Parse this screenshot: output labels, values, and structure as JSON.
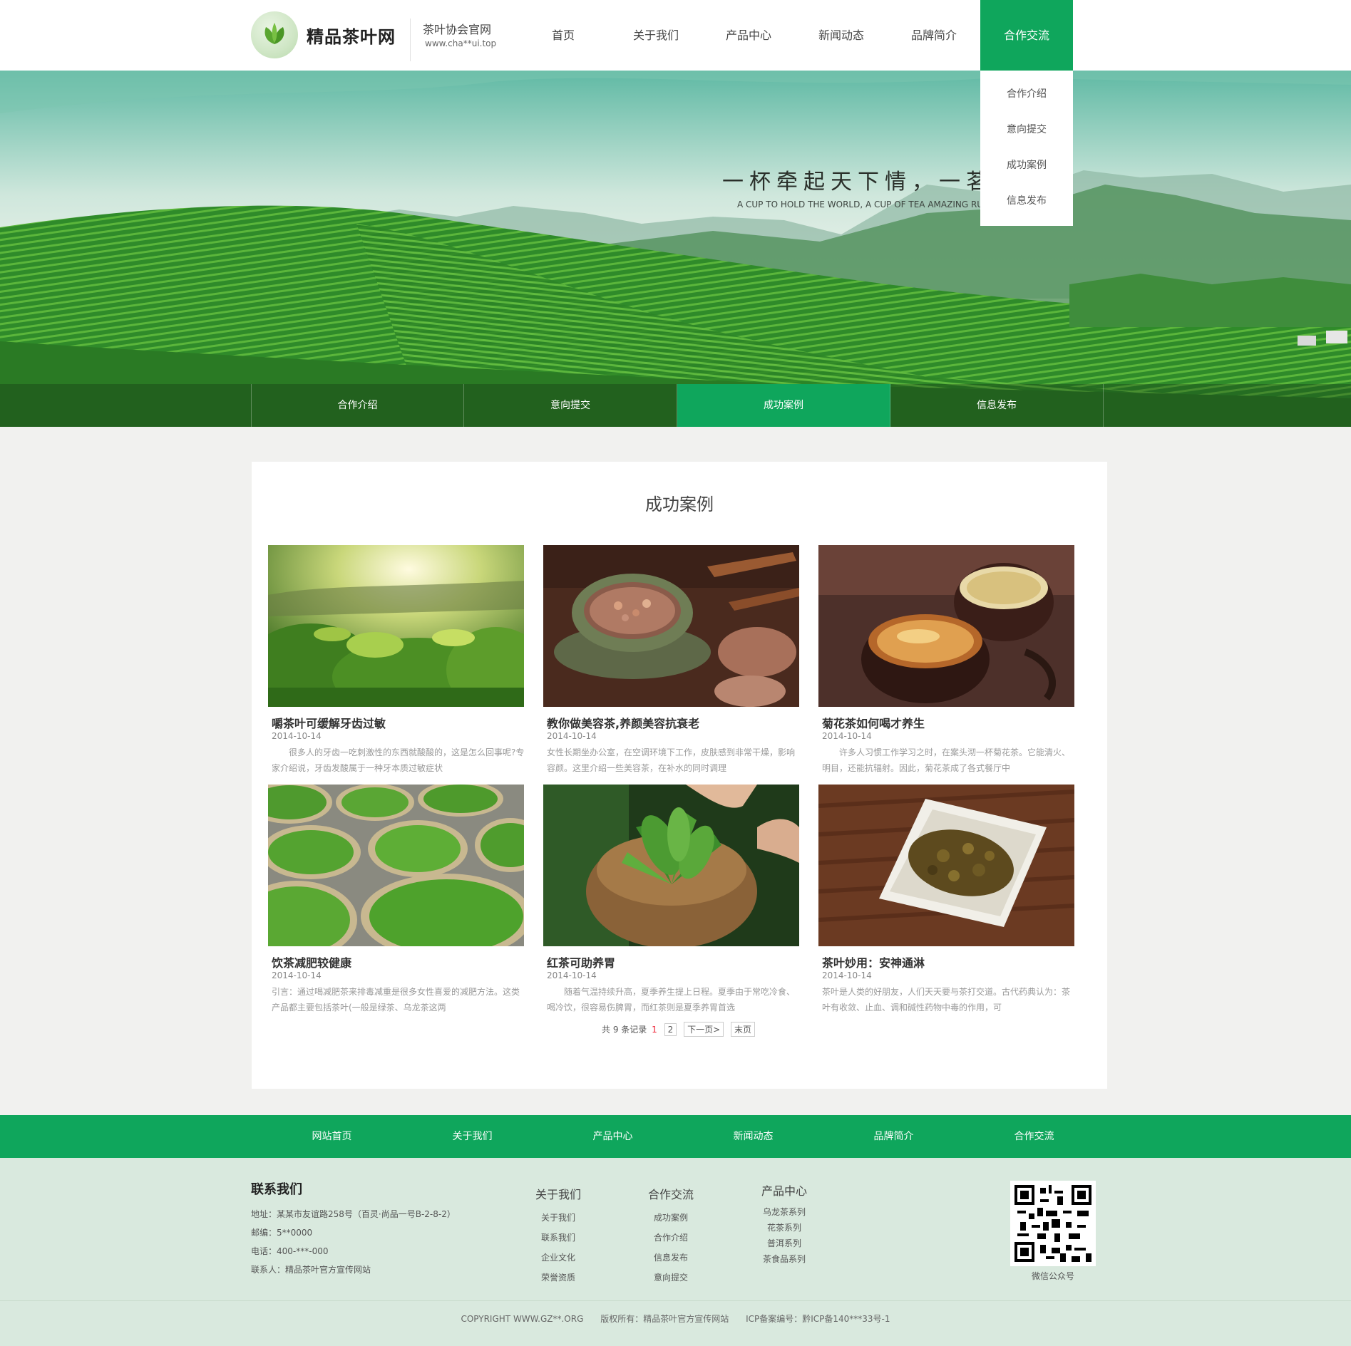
{
  "header": {
    "logo_text": "精品茶叶网",
    "tagline": "茶叶协会官网",
    "site_url": "www.cha**ui.top",
    "nav": [
      {
        "label": "首页"
      },
      {
        "label": "关于我们"
      },
      {
        "label": "产品中心"
      },
      {
        "label": "新闻动态"
      },
      {
        "label": "品牌简介"
      },
      {
        "label": "合作交流"
      }
    ],
    "active_nav": "合作交流",
    "dropdown": [
      {
        "label": "合作介绍"
      },
      {
        "label": "意向提交"
      },
      {
        "label": "成功案例"
      },
      {
        "label": "信息发布"
      }
    ]
  },
  "banner": {
    "slogan": "一杯牵起天下情，一茗惊人",
    "slogan_en": "A CUP TO HOLD THE WORLD, A CUP OF TEA AMAZING RUI",
    "subnav": [
      {
        "label": "合作介绍"
      },
      {
        "label": "意向提交"
      },
      {
        "label": "成功案例"
      },
      {
        "label": "信息发布"
      }
    ],
    "active_subnav": "成功案例"
  },
  "main": {
    "title": "成功案例",
    "cards": [
      {
        "title": "嚼茶叶可缓解牙齿过敏",
        "date": "2014-10-14",
        "desc": "　　很多人的牙齿一吃刺激性的东西就酸酸的，这是怎么回事呢?专家介绍说，牙齿发酸属于一种牙本质过敏症状",
        "image": "tea-plantation-sunlight"
      },
      {
        "title": "教你做美容茶,养颜美容抗衰老",
        "date": "2014-10-14",
        "desc": "女性长期坐办公室，在空调环境下工作，皮肤感到非常干燥，影响容颜。这里介绍一些美容茶，在补水的同时调理",
        "image": "flower-tea-bowl"
      },
      {
        "title": "菊花茶如何喝才养生",
        "date": "2014-10-14",
        "desc": "　　许多人习惯工作学习之时，在案头沏一杯菊花茶。它能清火、明目，还能抗辐射。因此，菊花茶成了各式餐厅中",
        "image": "tea-cups"
      },
      {
        "title": "饮茶减肥较健康",
        "date": "2014-10-14",
        "desc": "引言：通过喝减肥茶来排毒减重是很多女性喜爱的减肥方法。这类产品都主要包括茶叶(一般是绿茶、乌龙茶这两",
        "image": "drying-tea-baskets"
      },
      {
        "title": "红茶可助养胃",
        "date": "2014-10-14",
        "desc": "　　随着气温持续升高，夏季养生提上日程。夏季由于常吃冷食、喝冷饮，很容易伤脾胃，而红茶则是夏季养胃首选",
        "image": "tea-leaves-basket"
      },
      {
        "title": "茶叶妙用：安神通淋",
        "date": "2014-10-14",
        "desc": "茶叶是人类的好朋友，人们天天要与茶打交道。古代药典认为：茶叶有收敛、止血、调和碱性药物中毒的作用，可",
        "image": "dried-tea-dish"
      }
    ],
    "pager": {
      "summary": "共 9 条记录",
      "current": "1",
      "page2": "2",
      "next": "下一页>",
      "last": "末页"
    }
  },
  "footer_nav": [
    {
      "label": "网站首页"
    },
    {
      "label": "关于我们"
    },
    {
      "label": "产品中心"
    },
    {
      "label": "新闻动态"
    },
    {
      "label": "品牌简介"
    },
    {
      "label": "合作交流"
    }
  ],
  "footer": {
    "contact_title": "联系我们",
    "address": "地址：某某市友谊路258号（百灵·尚品一号B-2-8-2）",
    "postcode": "邮编：5**0000",
    "phone": "电话：400-***-000",
    "contact_person": "联系人：精品茶叶官方宣传网站",
    "columns": [
      {
        "title": "关于我们",
        "links": [
          "关于我们",
          "联系我们",
          "企业文化",
          "荣誉资质"
        ]
      },
      {
        "title": "合作交流",
        "links": [
          "成功案例",
          "合作介绍",
          "信息发布",
          "意向提交"
        ]
      },
      {
        "title": "产品中心",
        "links": [
          "乌龙茶系列",
          "花茶系列",
          "普洱系列",
          "茶食品系列"
        ]
      }
    ],
    "qr_label": "微信公众号",
    "copyright": "COPYRIGHT WWW.GZ**.ORG",
    "rights": "版权所有：精品茶叶官方宣传网站",
    "icp": "ICP备案编号：黔ICP备140***33号-1"
  },
  "colors": {
    "accent": "#0fa65c",
    "footer_bg": "#d9e9de"
  }
}
